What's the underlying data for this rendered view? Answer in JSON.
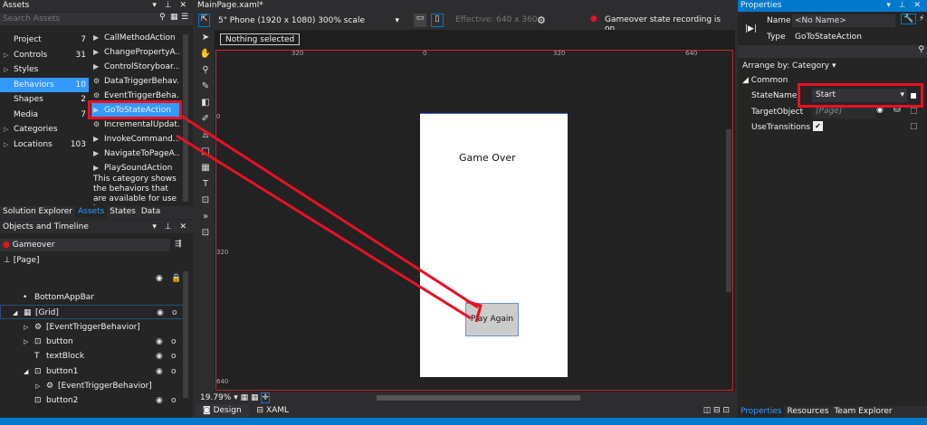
{
  "assets": {
    "title": "Assets",
    "search_placeholder": "Search Assets",
    "categories": [
      {
        "label": "Project",
        "count": "7",
        "expand": false
      },
      {
        "label": "Controls",
        "count": "31",
        "expand": true
      },
      {
        "label": "Styles",
        "count": "",
        "expand": true
      },
      {
        "label": "Behaviors",
        "count": "10",
        "expand": false
      },
      {
        "label": "Shapes",
        "count": "2",
        "expand": false
      },
      {
        "label": "Media",
        "count": "7",
        "expand": false
      },
      {
        "label": "Categories",
        "count": "",
        "expand": true
      },
      {
        "label": "Locations",
        "count": "103",
        "expand": true
      }
    ],
    "items": [
      "CallMethodAction",
      "ChangePropertyA...",
      "ControlStoryboar...",
      "DataTriggerBehav...",
      "EventTriggerBeha...",
      "GoToStateAction",
      "IncrementalUpdat...",
      "InvokeCommand...",
      "NavigateToPageA...",
      "PlaySoundAction"
    ],
    "description": "This category shows the behaviors that are available for use in",
    "tabs": [
      "Solution Explorer",
      "Assets",
      "States",
      "Data"
    ]
  },
  "objects": {
    "title": "Objects and Timeline",
    "state": "Gameover",
    "root": "[Page]",
    "tree": [
      {
        "label": "BottomAppBar",
        "indent": 1,
        "icon": "•",
        "eye": false
      },
      {
        "label": "[Grid]",
        "indent": 1,
        "icon": "▦",
        "exp": "◢",
        "eye": true
      },
      {
        "label": "[EventTriggerBehavior]",
        "indent": 2,
        "icon": "⚙",
        "exp": "▷",
        "eye": false
      },
      {
        "label": "button",
        "indent": 2,
        "icon": "⊡",
        "exp": "▷",
        "eye": true
      },
      {
        "label": "textBlock",
        "indent": 2,
        "icon": "T",
        "eye": true
      },
      {
        "label": "button1",
        "indent": 2,
        "icon": "⊡",
        "exp": "◢",
        "eye": true
      },
      {
        "label": "[EventTriggerBehavior]",
        "indent": 3,
        "icon": "⚙",
        "exp": "▷",
        "eye": false
      },
      {
        "label": "button2",
        "indent": 2,
        "icon": "⊡",
        "eye": true
      }
    ]
  },
  "editor": {
    "tab": "MainPage.xaml*",
    "device": "5\" Phone (1920 x 1080) 300% scale",
    "effective": "Effective: 640 x 360",
    "recording": "Gameover state recording is on.",
    "selection": "Nothing selected",
    "ruler_top": [
      "320",
      "0",
      "320",
      "640"
    ],
    "ruler_left": [
      "0",
      "320",
      "640"
    ],
    "page_text": "Game Over",
    "button": "Play Again",
    "zoom": "19.79%",
    "view_tabs": [
      "Design",
      "XAML"
    ]
  },
  "properties": {
    "title": "Properties",
    "name_label": "Name",
    "name_value": "<No Name>",
    "type_label": "Type",
    "type_value": "GoToStateAction",
    "arrange": "Arrange by: Category ▾",
    "section": "Common",
    "rows": [
      {
        "label": "StateName",
        "value": "Start"
      },
      {
        "label": "TargetObject",
        "value": "[Page]"
      },
      {
        "label": "UseTransitions",
        "value": "✔"
      }
    ],
    "tabs": [
      "Properties",
      "Resources",
      "Team Explorer"
    ]
  },
  "colors": {
    "accent": "#007acc",
    "highlight": "#e81123",
    "selection": "#3399ff"
  }
}
